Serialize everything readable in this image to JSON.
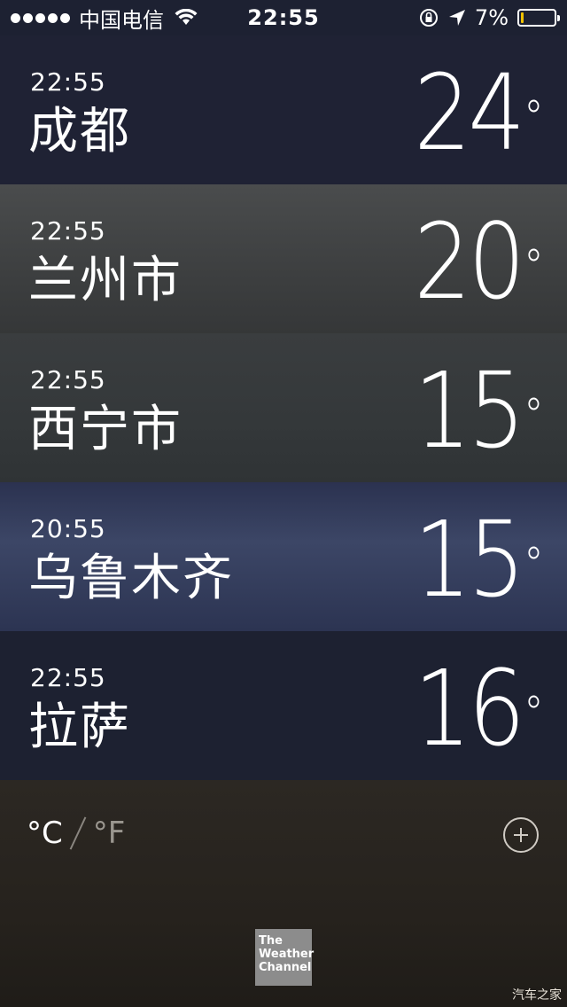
{
  "status_bar": {
    "carrier": "中国电信",
    "time": "22:55",
    "battery": "7%"
  },
  "cities": [
    {
      "time": "22:55",
      "name": "成都",
      "temp": "24",
      "deg": "°"
    },
    {
      "time": "22:55",
      "name": "兰州市",
      "temp": "20",
      "deg": "°"
    },
    {
      "time": "22:55",
      "name": "西宁市",
      "temp": "15",
      "deg": "°"
    },
    {
      "time": "20:55",
      "name": "乌鲁木齐",
      "temp": "15",
      "deg": "°"
    },
    {
      "time": "22:55",
      "name": "拉萨",
      "temp": "16",
      "deg": "°"
    }
  ],
  "units": {
    "celsius": "°C",
    "fahrenheit": "°F"
  },
  "logo": {
    "line1": "The",
    "line2": "Weather",
    "line3": "Channel"
  },
  "watermark": "汽车之家"
}
